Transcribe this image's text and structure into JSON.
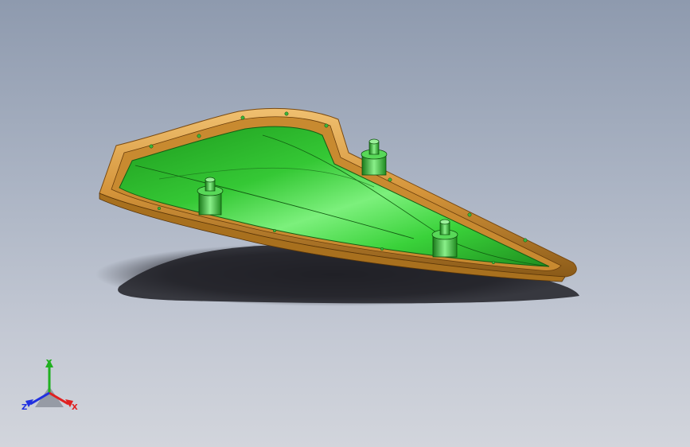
{
  "viewport": {
    "background_top": "#8e9aae",
    "background_bottom": "#d2d5dc"
  },
  "model": {
    "inner_color": "#33c233",
    "inner_highlight": "#7ef07e",
    "rim_color": "#d79a3a",
    "rim_shadow": "#9a6418",
    "boss_count": 3
  },
  "triad": {
    "x_label": "X",
    "y_label": "Y",
    "z_label": "Z",
    "x_color": "#e02020",
    "y_color": "#20b020",
    "z_color": "#2030e0"
  }
}
